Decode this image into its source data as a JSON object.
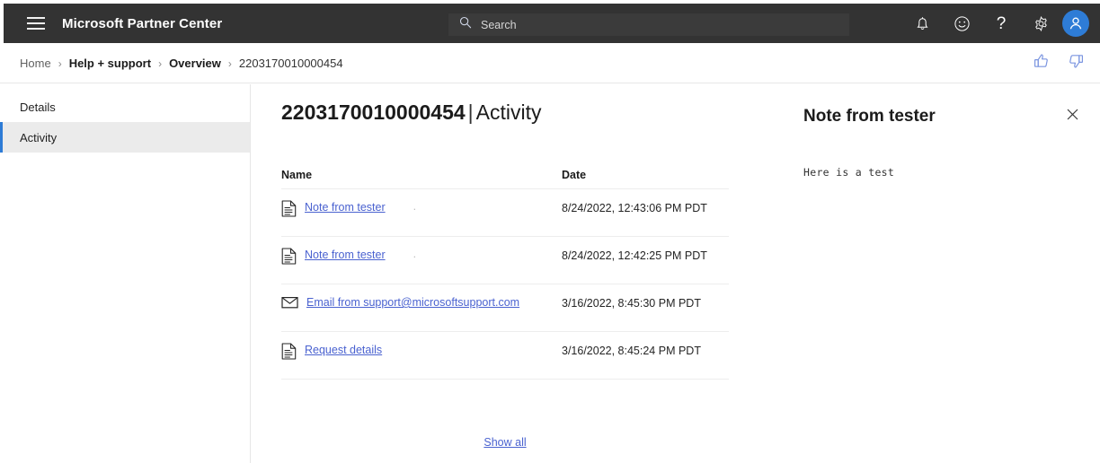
{
  "topbar": {
    "menu_icon": "hamburger-icon",
    "brand": "Microsoft Partner Center",
    "search": {
      "placeholder": "Search",
      "value": "",
      "icon": "search-icon"
    },
    "icons": [
      {
        "name": "notifications-icon",
        "label": "Notifications"
      },
      {
        "name": "feedback-smiley-icon",
        "label": "Feedback"
      },
      {
        "name": "help-question-icon",
        "label": "?"
      },
      {
        "name": "settings-gear-icon",
        "label": "Settings"
      },
      {
        "name": "account-avatar",
        "label": "Account"
      }
    ],
    "accent_color": "#2e7cd6",
    "background_color": "#333333"
  },
  "breadcrumb": {
    "separator": "›",
    "items": [
      {
        "label": "Home",
        "style": "muted"
      },
      {
        "label": "Help + support",
        "style": "strong"
      },
      {
        "label": "Overview",
        "style": "strong"
      },
      {
        "label": "2203170010000454",
        "style": "current"
      }
    ],
    "feedback": [
      {
        "name": "thumbs-up-icon",
        "label": "Like"
      },
      {
        "name": "thumbs-down-icon",
        "label": "Dislike"
      }
    ]
  },
  "sidebar": {
    "items": [
      {
        "label": "Details",
        "selected": false
      },
      {
        "label": "Activity",
        "selected": true
      }
    ],
    "selected_accent": "#2e7cd6",
    "selected_background": "#ebebeb"
  },
  "main": {
    "title_id": "2203170010000454",
    "title_separator": "|",
    "title_section": "Activity",
    "table": {
      "columns": [
        "Name",
        "Date"
      ],
      "rows": [
        {
          "icon": "document-icon",
          "name": "Note from tester",
          "date": "8/24/2022, 12:43:06 PM PDT",
          "trailing": "."
        },
        {
          "icon": "document-icon",
          "name": "Note from tester",
          "date": "8/24/2022, 12:42:25 PM PDT",
          "trailing": "."
        },
        {
          "icon": "email-icon",
          "name": "Email from support@microsoftsupport.com",
          "date": "3/16/2022, 8:45:30 PM PDT",
          "trailing": ""
        },
        {
          "icon": "document-icon",
          "name": "Request details",
          "date": "3/16/2022, 8:45:24 PM PDT",
          "trailing": ""
        }
      ]
    },
    "show_all_label": "Show all",
    "link_color": "#4a62d0"
  },
  "detail_panel": {
    "title": "Note from tester",
    "body": "Here is a test",
    "close_icon": "close-icon"
  }
}
